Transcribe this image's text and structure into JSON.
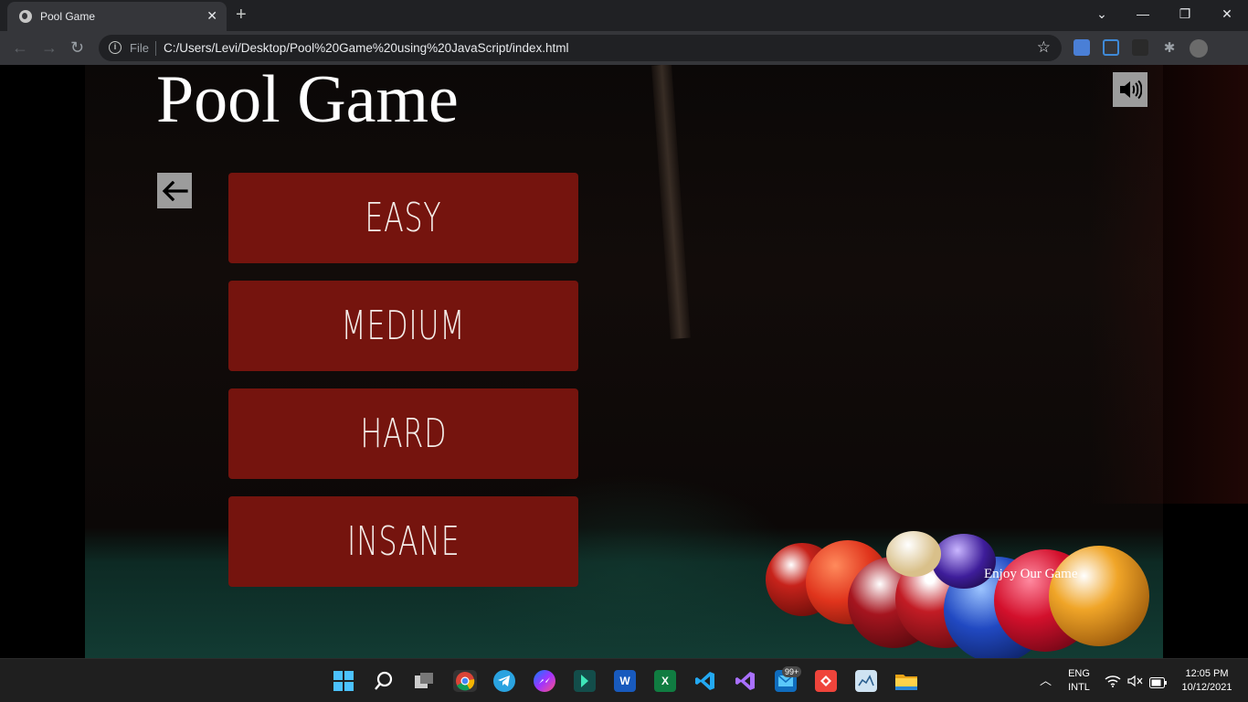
{
  "browser": {
    "tab_title": "Pool Game",
    "tab_close": "✕",
    "new_tab": "+",
    "window_controls": {
      "dropdown": "⌄",
      "minimize": "—",
      "restore": "❐",
      "close": "✕"
    },
    "address": {
      "scheme_label": "File",
      "url": "C:/Users/Levi/Desktop/Pool%20Game%20using%20JavaScript/index.html"
    }
  },
  "page": {
    "title": "Pool Game",
    "levels": [
      "EASY",
      "MEDIUM",
      "HARD",
      "INSANE"
    ],
    "footer_text": "Enjoy Our Game",
    "colors": {
      "button_bg": "#75140e",
      "icon_button_bg": "#9c9c9c",
      "text": "#ffffff"
    }
  },
  "taskbar": {
    "mail_badge": "99+",
    "language": "ENG",
    "layout": "INTL",
    "time": "12:05 PM",
    "date": "10/12/2021",
    "apps": [
      "windows-start",
      "search",
      "task-view",
      "chrome",
      "telegram",
      "messenger",
      "app-green",
      "word",
      "excel",
      "vscode",
      "visual-studio",
      "mail",
      "anydesk",
      "app-chart",
      "file-explorer"
    ]
  }
}
